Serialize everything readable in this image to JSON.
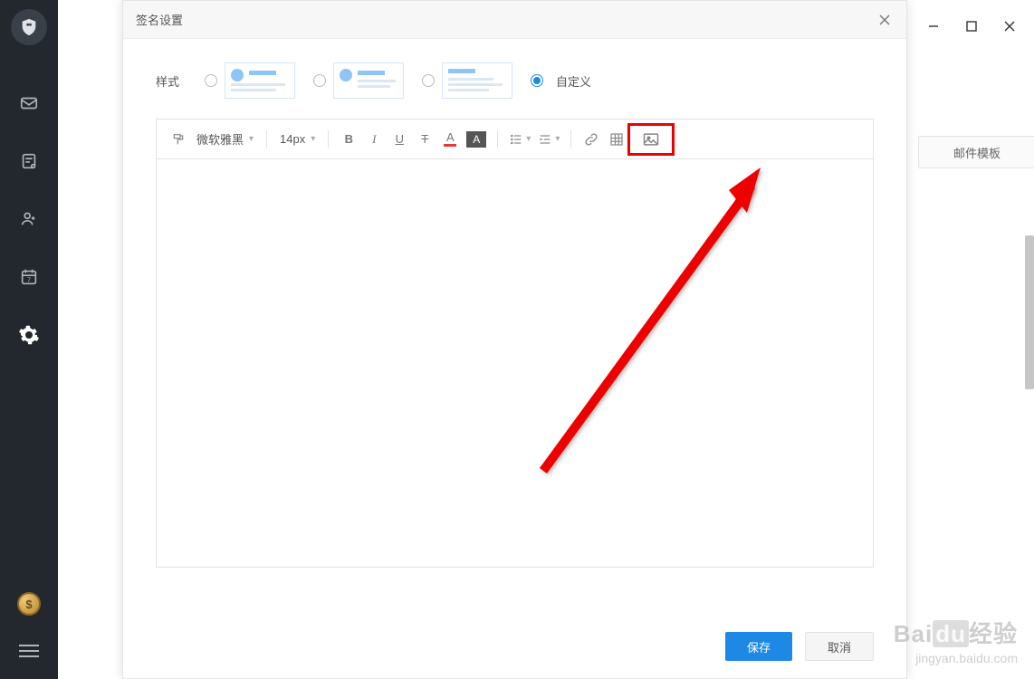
{
  "dialog": {
    "title": "签名设置",
    "style_label": "样式",
    "custom_label": "自定义",
    "save_label": "保存",
    "cancel_label": "取消"
  },
  "toolbar": {
    "font_family": "微软雅黑",
    "font_size": "14px",
    "bold": "B",
    "italic": "I",
    "underline": "U",
    "strike": "T",
    "font_color": "A",
    "bg_color": "A"
  },
  "side_tab_label": "邮件模板",
  "watermark": {
    "brand_prefix": "Bai",
    "brand_mid": "du",
    "brand_suffix": "经验",
    "url": "jingyan.baidu.com"
  },
  "sidebar": {
    "coin_symbol": "$"
  }
}
